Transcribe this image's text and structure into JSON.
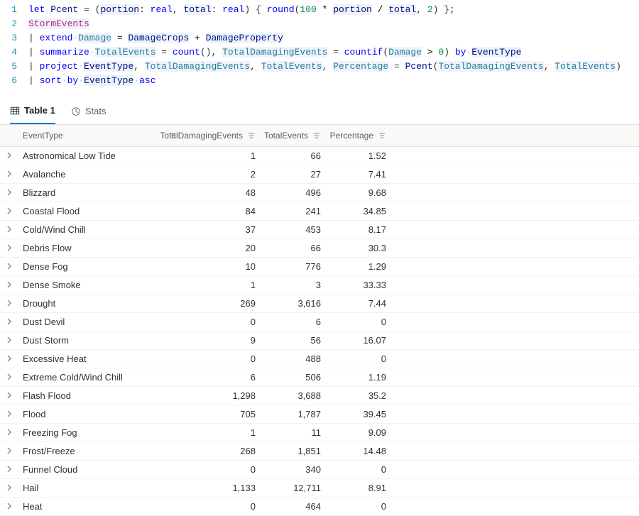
{
  "editor": {
    "lines": [
      [
        {
          "t": "let ",
          "c": "tok-kw"
        },
        {
          "t": "Pcent",
          "c": "tok-id"
        },
        {
          "t": " = (",
          "c": "tok-punc"
        },
        {
          "t": "portion",
          "c": "tok-id hl-bg"
        },
        {
          "t": ": ",
          "c": "tok-punc"
        },
        {
          "t": "real",
          "c": "tok-kw"
        },
        {
          "t": ", ",
          "c": "tok-punc"
        },
        {
          "t": "total",
          "c": "tok-id hl-bg"
        },
        {
          "t": ": ",
          "c": "tok-punc"
        },
        {
          "t": "real",
          "c": "tok-kw"
        },
        {
          "t": ") { ",
          "c": "tok-punc"
        },
        {
          "t": "round",
          "c": "tok-fn"
        },
        {
          "t": "(",
          "c": "tok-punc"
        },
        {
          "t": "100",
          "c": "tok-num"
        },
        {
          "t": " * ",
          "c": "tok-op"
        },
        {
          "t": "portion",
          "c": "tok-id hl-bg"
        },
        {
          "t": " / ",
          "c": "tok-op"
        },
        {
          "t": "total",
          "c": "tok-id hl-bg"
        },
        {
          "t": ", ",
          "c": "tok-punc"
        },
        {
          "t": "2",
          "c": "tok-num"
        },
        {
          "t": ") };",
          "c": "tok-punc"
        }
      ],
      [
        {
          "t": "StormEvents",
          "c": "tok-tbl hl-bg"
        }
      ],
      [
        {
          "t": "| ",
          "c": "tok-pipe"
        },
        {
          "t": "extend",
          "c": "tok-kw"
        },
        {
          "t": " ",
          "c": "tok-dot",
          "dot": true
        },
        {
          "t": "Damage",
          "c": "tok-id2 hl-bg"
        },
        {
          "t": " = ",
          "c": "tok-punc"
        },
        {
          "t": "DamageCrops",
          "c": "tok-id hl-bg"
        },
        {
          "t": " + ",
          "c": "tok-op"
        },
        {
          "t": "DamageProperty",
          "c": "tok-id hl-bg"
        }
      ],
      [
        {
          "t": "| ",
          "c": "tok-pipe"
        },
        {
          "t": "summarize",
          "c": "tok-kw"
        },
        {
          "t": " ",
          "c": "tok-dot",
          "dot": true
        },
        {
          "t": "TotalEvents",
          "c": "tok-id2 hl-bg"
        },
        {
          "t": " = ",
          "c": "tok-punc"
        },
        {
          "t": "count",
          "c": "tok-fn"
        },
        {
          "t": "(), ",
          "c": "tok-punc"
        },
        {
          "t": "TotalDamagingEvents",
          "c": "tok-id2 hl-bg"
        },
        {
          "t": " = ",
          "c": "tok-punc"
        },
        {
          "t": "countif",
          "c": "tok-fn"
        },
        {
          "t": "(",
          "c": "tok-punc"
        },
        {
          "t": "Damage",
          "c": "tok-id2 hl-bg"
        },
        {
          "t": " > ",
          "c": "tok-op"
        },
        {
          "t": "0",
          "c": "tok-num"
        },
        {
          "t": ") ",
          "c": "tok-punc"
        },
        {
          "t": "by",
          "c": "tok-kw"
        },
        {
          "t": " ",
          "c": "tok-dot",
          "dot": true
        },
        {
          "t": "EventType",
          "c": "tok-id hl-bg"
        }
      ],
      [
        {
          "t": "| ",
          "c": "tok-pipe"
        },
        {
          "t": "project",
          "c": "tok-kw"
        },
        {
          "t": " ",
          "c": "tok-dot",
          "dot": true
        },
        {
          "t": "EventType",
          "c": "tok-id hl-bg"
        },
        {
          "t": ", ",
          "c": "tok-punc"
        },
        {
          "t": "TotalDamagingEvents",
          "c": "tok-id2 hl-bg"
        },
        {
          "t": ", ",
          "c": "tok-punc"
        },
        {
          "t": "TotalEvents",
          "c": "tok-id2 hl-bg"
        },
        {
          "t": ", ",
          "c": "tok-punc"
        },
        {
          "t": "Percentage",
          "c": "tok-id2 hl-bg"
        },
        {
          "t": " = ",
          "c": "tok-punc"
        },
        {
          "t": "Pcent",
          "c": "tok-id"
        },
        {
          "t": "(",
          "c": "tok-punc"
        },
        {
          "t": "TotalDamagingEvents",
          "c": "tok-id2 hl-bg"
        },
        {
          "t": ", ",
          "c": "tok-punc"
        },
        {
          "t": "TotalEvents",
          "c": "tok-id2 hl-bg"
        },
        {
          "t": ")",
          "c": "tok-punc"
        }
      ],
      [
        {
          "t": "| ",
          "c": "tok-pipe"
        },
        {
          "t": "sort",
          "c": "tok-kw"
        },
        {
          "t": " ",
          "c": "tok-dot",
          "dot": true
        },
        {
          "t": "by",
          "c": "tok-kw"
        },
        {
          "t": " ",
          "c": "tok-dot",
          "dot": true
        },
        {
          "t": "EventType",
          "c": "tok-id hl-bg"
        },
        {
          "t": " ",
          "c": "tok-dot",
          "dot": true
        },
        {
          "t": "asc",
          "c": "tok-kw"
        }
      ]
    ]
  },
  "tabs": {
    "table_label": "Table 1",
    "stats_label": "Stats"
  },
  "table": {
    "columns": {
      "event_type": "EventType",
      "total_damaging": "TotalDamagingEvents",
      "total_events": "TotalEvents",
      "percentage": "Percentage"
    },
    "rows": [
      {
        "name": "Astronomical Low Tide",
        "tde": "1",
        "tot": "66",
        "pct": "1.52"
      },
      {
        "name": "Avalanche",
        "tde": "2",
        "tot": "27",
        "pct": "7.41"
      },
      {
        "name": "Blizzard",
        "tde": "48",
        "tot": "496",
        "pct": "9.68"
      },
      {
        "name": "Coastal Flood",
        "tde": "84",
        "tot": "241",
        "pct": "34.85"
      },
      {
        "name": "Cold/Wind Chill",
        "tde": "37",
        "tot": "453",
        "pct": "8.17"
      },
      {
        "name": "Debris Flow",
        "tde": "20",
        "tot": "66",
        "pct": "30.3"
      },
      {
        "name": "Dense Fog",
        "tde": "10",
        "tot": "776",
        "pct": "1.29"
      },
      {
        "name": "Dense Smoke",
        "tde": "1",
        "tot": "3",
        "pct": "33.33"
      },
      {
        "name": "Drought",
        "tde": "269",
        "tot": "3,616",
        "pct": "7.44"
      },
      {
        "name": "Dust Devil",
        "tde": "0",
        "tot": "6",
        "pct": "0"
      },
      {
        "name": "Dust Storm",
        "tde": "9",
        "tot": "56",
        "pct": "16.07"
      },
      {
        "name": "Excessive Heat",
        "tde": "0",
        "tot": "488",
        "pct": "0"
      },
      {
        "name": "Extreme Cold/Wind Chill",
        "tde": "6",
        "tot": "506",
        "pct": "1.19"
      },
      {
        "name": "Flash Flood",
        "tde": "1,298",
        "tot": "3,688",
        "pct": "35.2"
      },
      {
        "name": "Flood",
        "tde": "705",
        "tot": "1,787",
        "pct": "39.45"
      },
      {
        "name": "Freezing Fog",
        "tde": "1",
        "tot": "11",
        "pct": "9.09"
      },
      {
        "name": "Frost/Freeze",
        "tde": "268",
        "tot": "1,851",
        "pct": "14.48"
      },
      {
        "name": "Funnel Cloud",
        "tde": "0",
        "tot": "340",
        "pct": "0"
      },
      {
        "name": "Hail",
        "tde": "1,133",
        "tot": "12,711",
        "pct": "8.91"
      },
      {
        "name": "Heat",
        "tde": "0",
        "tot": "464",
        "pct": "0"
      }
    ]
  }
}
